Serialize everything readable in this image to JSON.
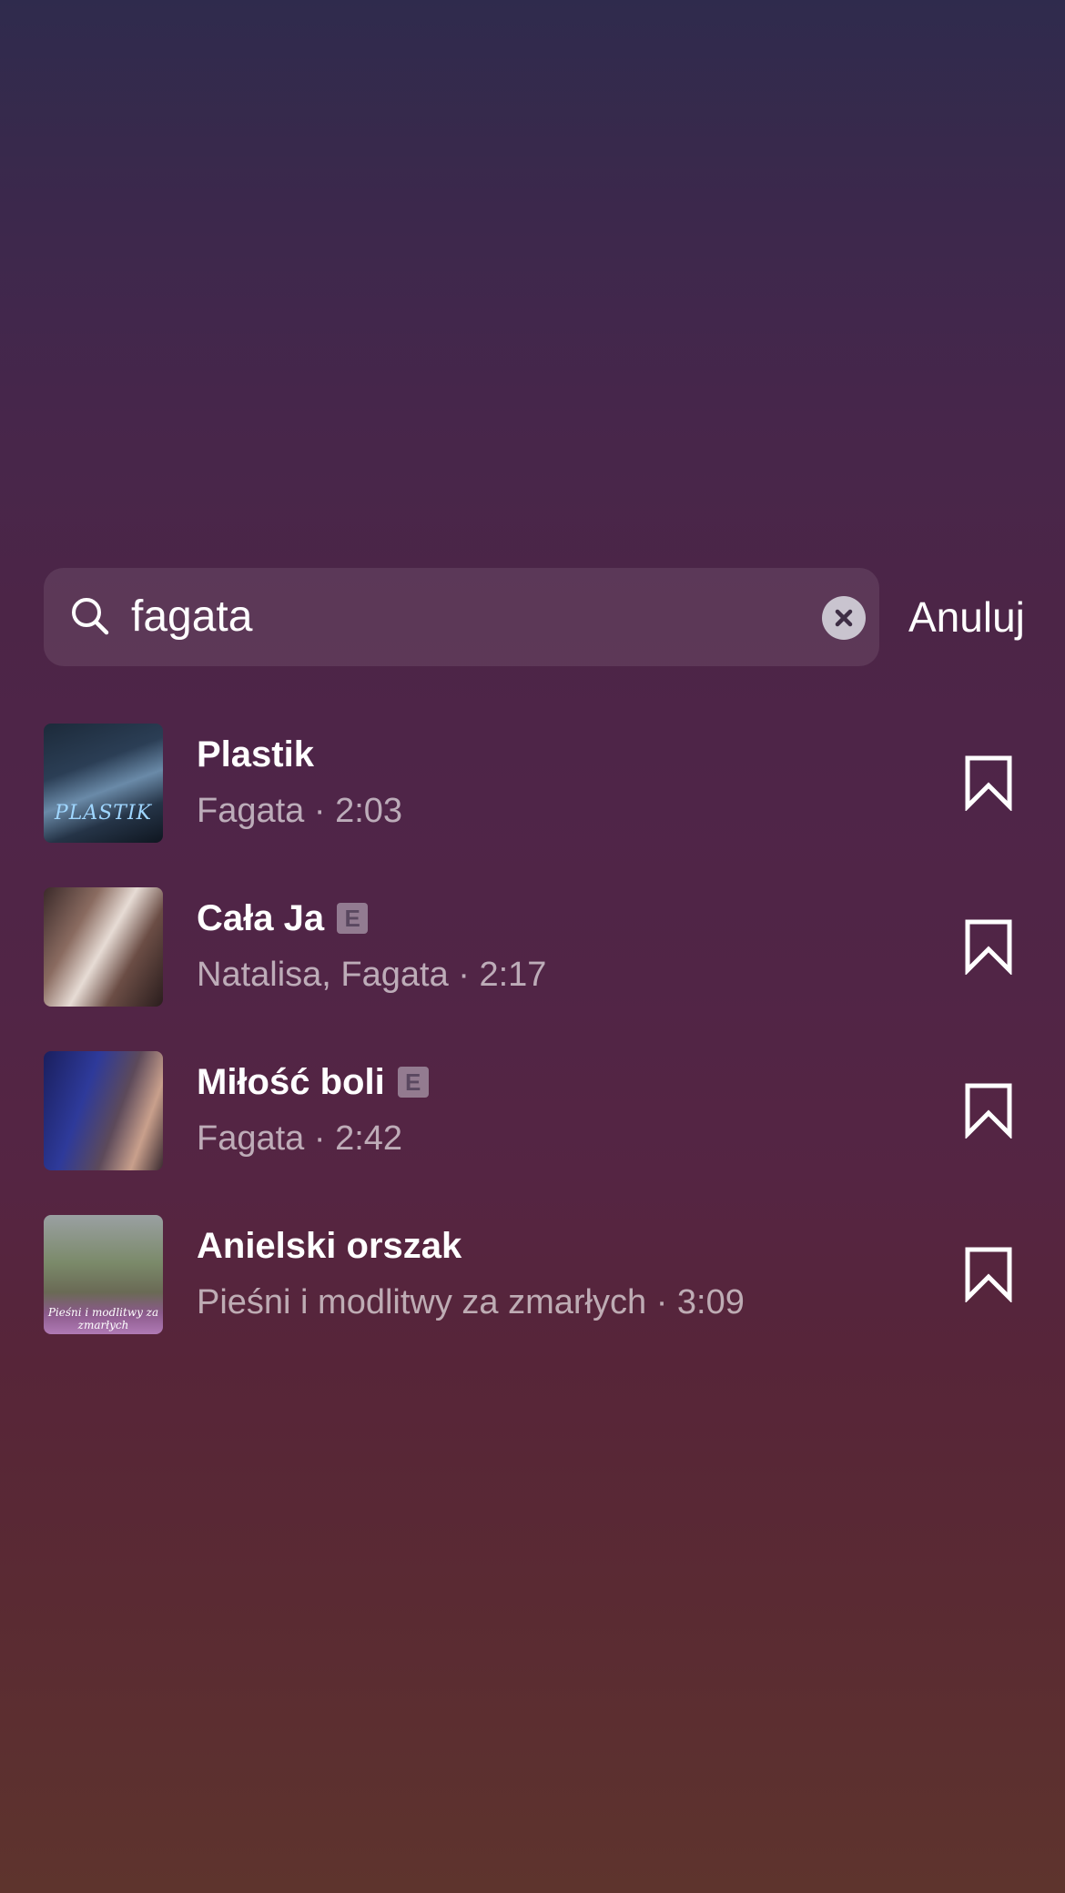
{
  "search": {
    "value": "fagata",
    "cancel_label": "Anuluj"
  },
  "results": [
    {
      "title": "Plastik",
      "explicit": false,
      "subtitle": "Fagata · 2:03",
      "cover_text": "PLASTIK"
    },
    {
      "title": "Cała Ja",
      "explicit": true,
      "explicit_label": "E",
      "subtitle": "Natalisa, Fagata · 2:17"
    },
    {
      "title": "Miłość boli",
      "explicit": true,
      "explicit_label": "E",
      "subtitle": "Fagata · 2:42"
    },
    {
      "title": "Anielski orszak",
      "explicit": false,
      "subtitle": "Pieśni i modlitwy za zmarłych · 3:09",
      "cover_text": "Pieśni i modlitwy za zmarłych"
    }
  ],
  "icons": {
    "search": "search-icon",
    "clear": "close-circle-icon",
    "save": "bookmark-icon"
  }
}
